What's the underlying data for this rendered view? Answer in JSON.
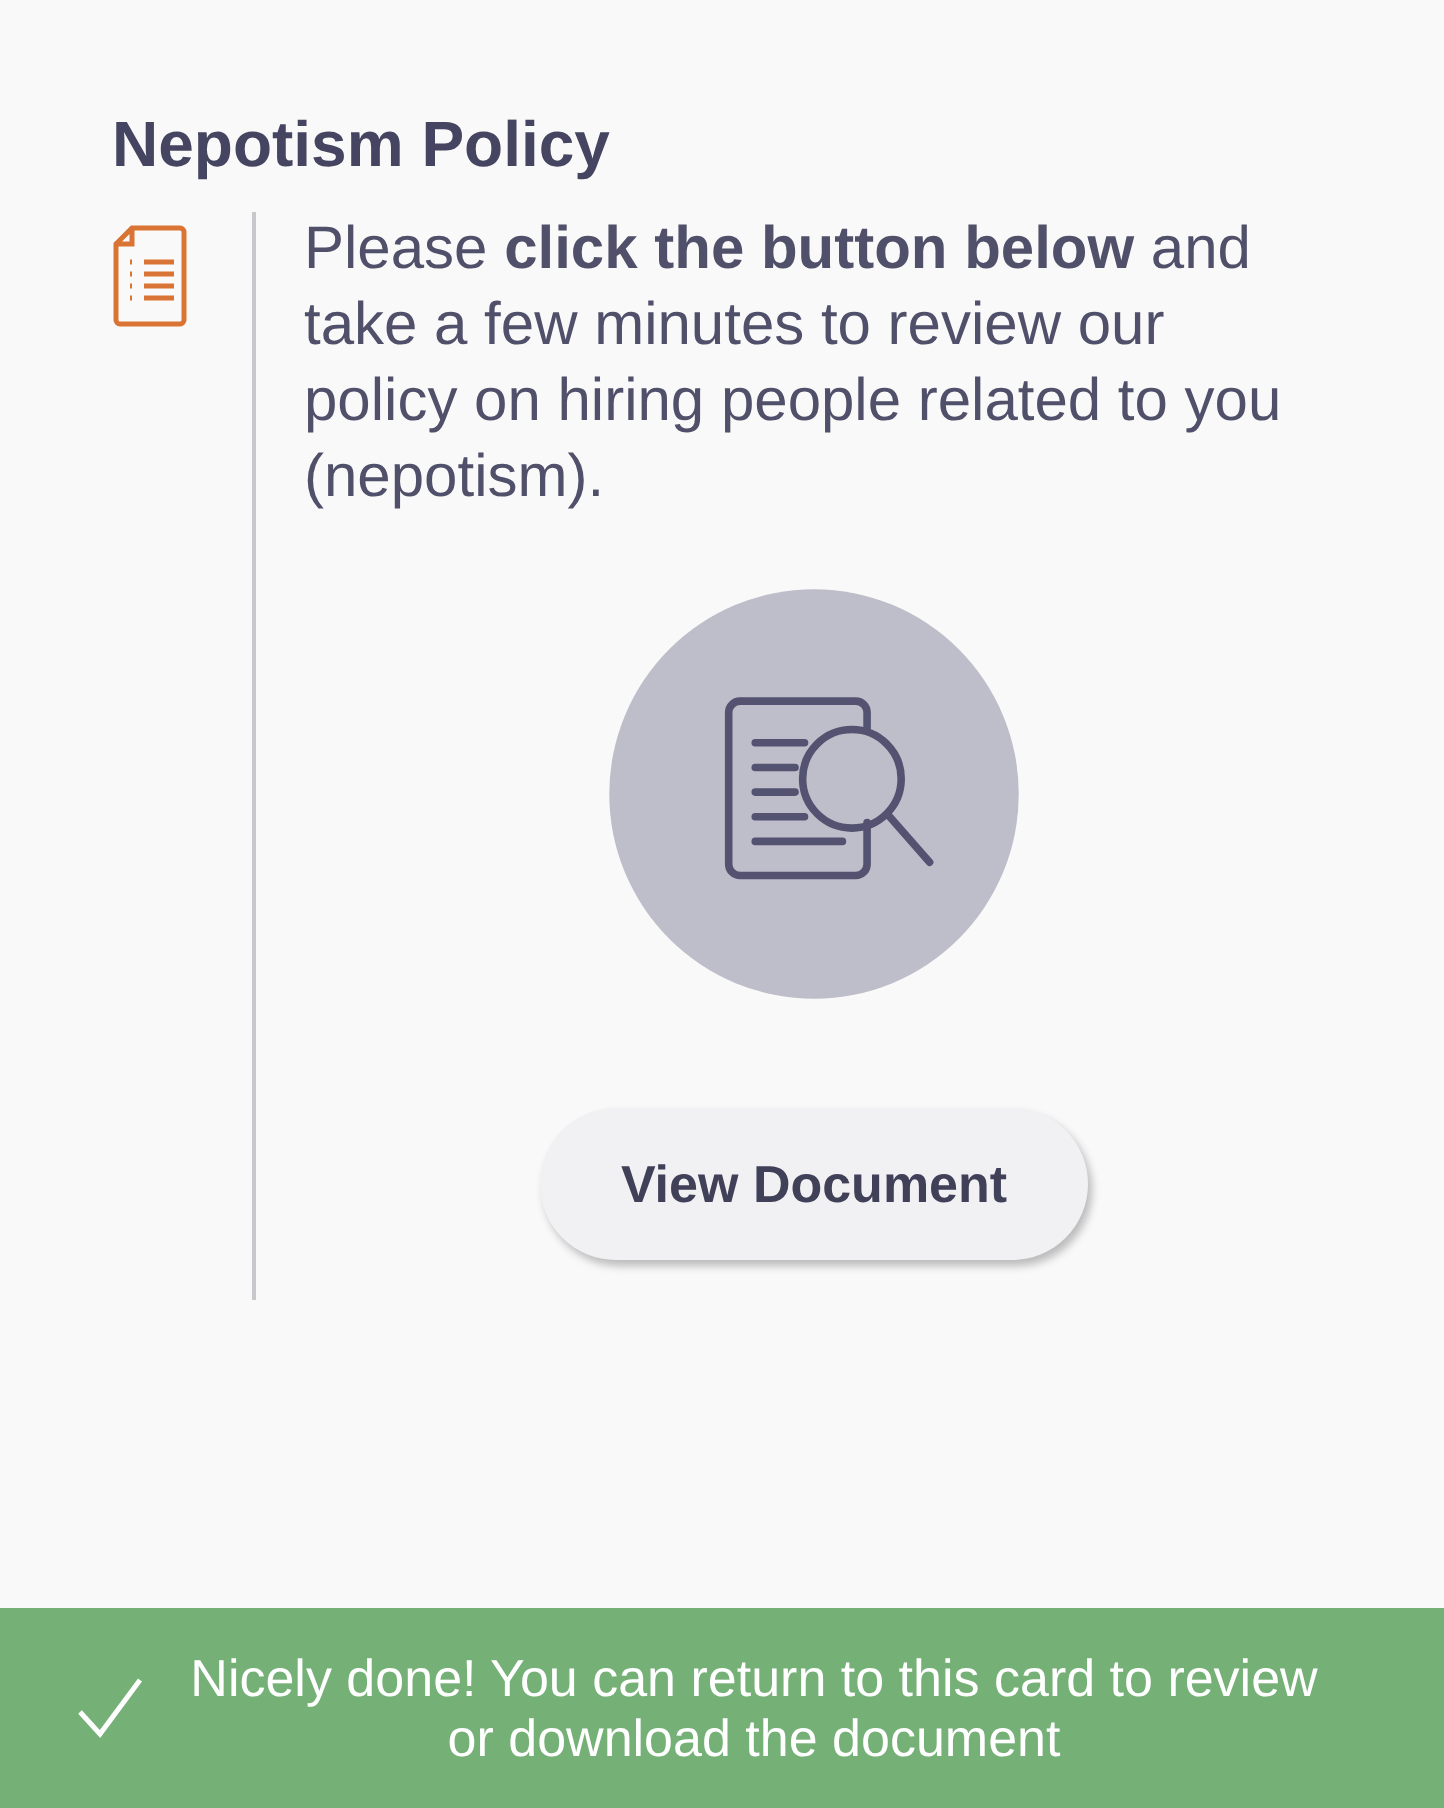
{
  "card": {
    "title": "Nepotism Policy",
    "body": "Please **click the button below** and take a few minutes to review our policy on hiring people related to you (nepotism).",
    "button": "View Document"
  },
  "toast": {
    "message": "Nicely done! You can return to this card to review or download the document"
  }
}
